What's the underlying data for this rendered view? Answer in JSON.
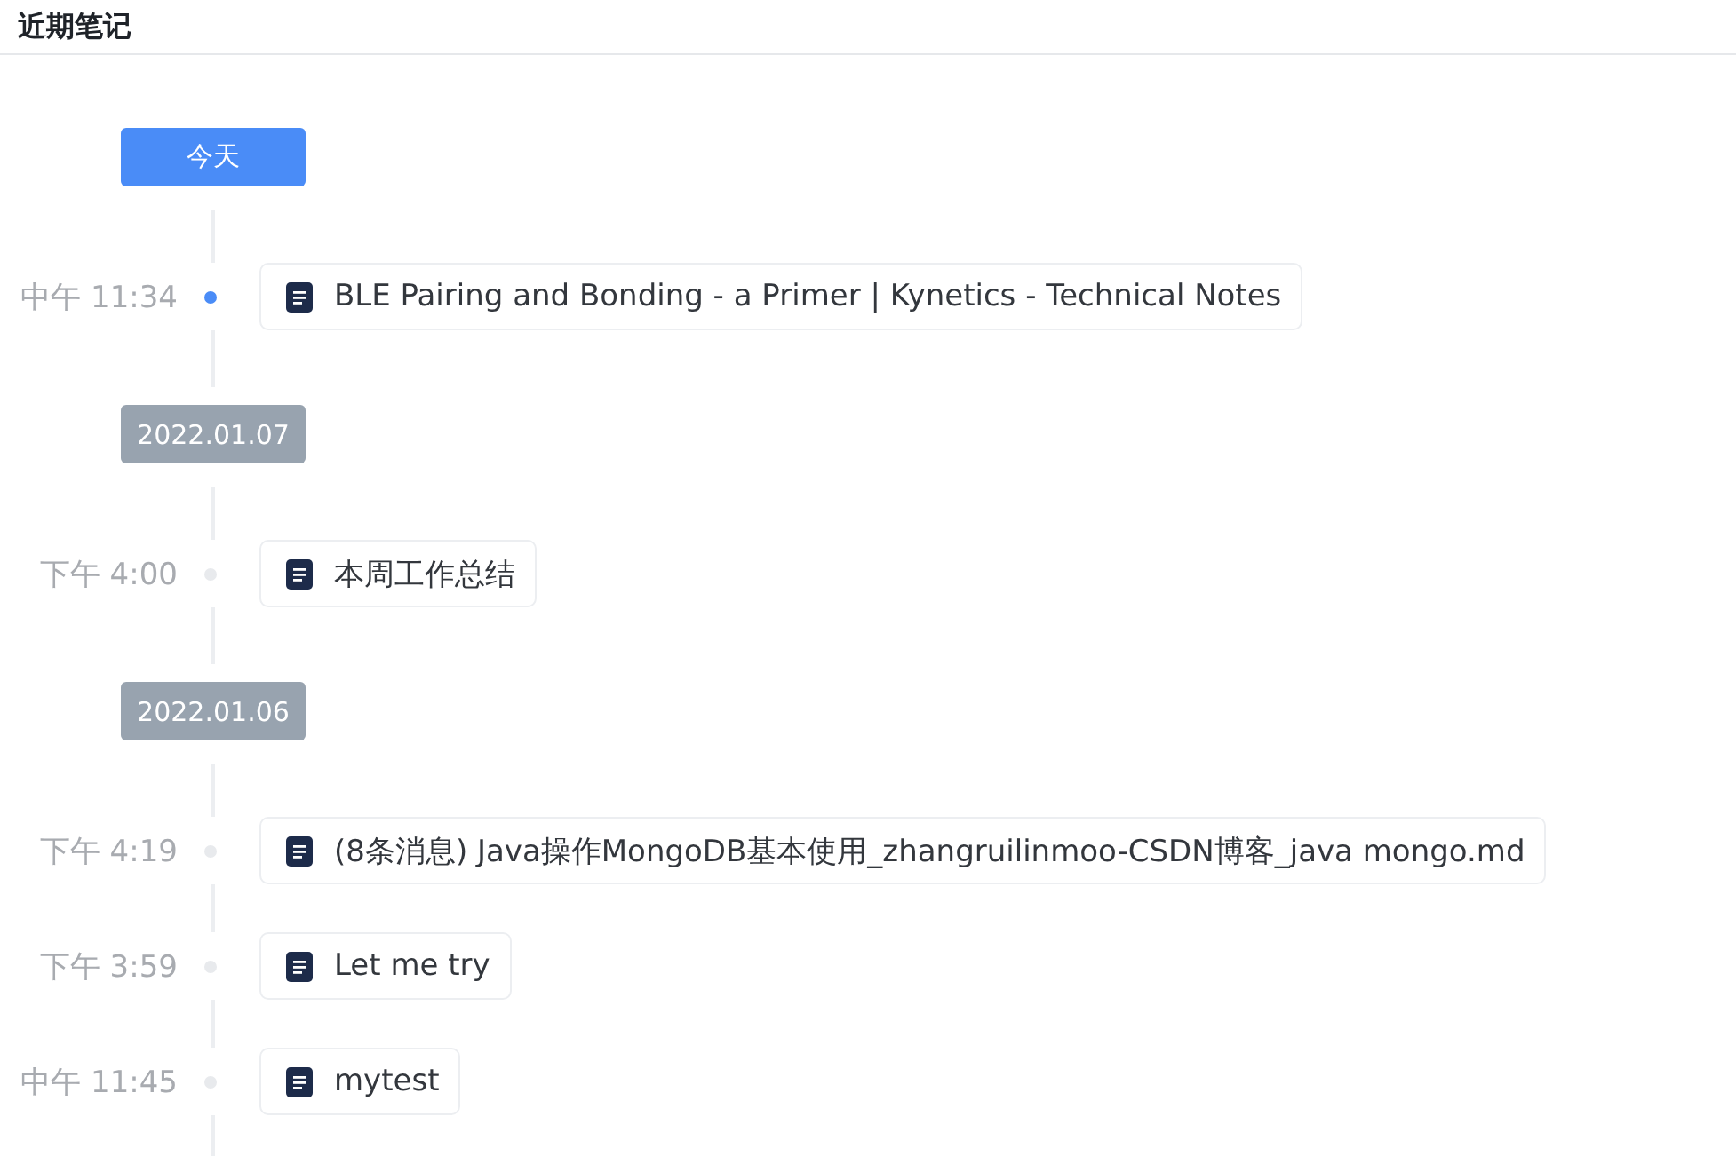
{
  "header": {
    "title": "近期笔记"
  },
  "groups": [
    {
      "label": "今天",
      "current": true,
      "notes": [
        {
          "time": "中午 11:34",
          "title": "BLE Pairing and Bonding - a Primer | Kynetics - Technical Notes",
          "highlighted": true
        }
      ]
    },
    {
      "label": "2022.01.07",
      "current": false,
      "notes": [
        {
          "time": "下午 4:00",
          "title": "本周工作总结",
          "highlighted": false
        }
      ]
    },
    {
      "label": "2022.01.06",
      "current": false,
      "notes": [
        {
          "time": "下午 4:19",
          "title": "(8条消息) Java操作MongoDB基本使用_zhangruilinmoo-CSDN博客_java mongo.md",
          "highlighted": false
        },
        {
          "time": "下午 3:59",
          "title": "Let me try",
          "highlighted": false
        },
        {
          "time": "中午 11:45",
          "title": "mytest",
          "highlighted": false
        }
      ]
    }
  ]
}
